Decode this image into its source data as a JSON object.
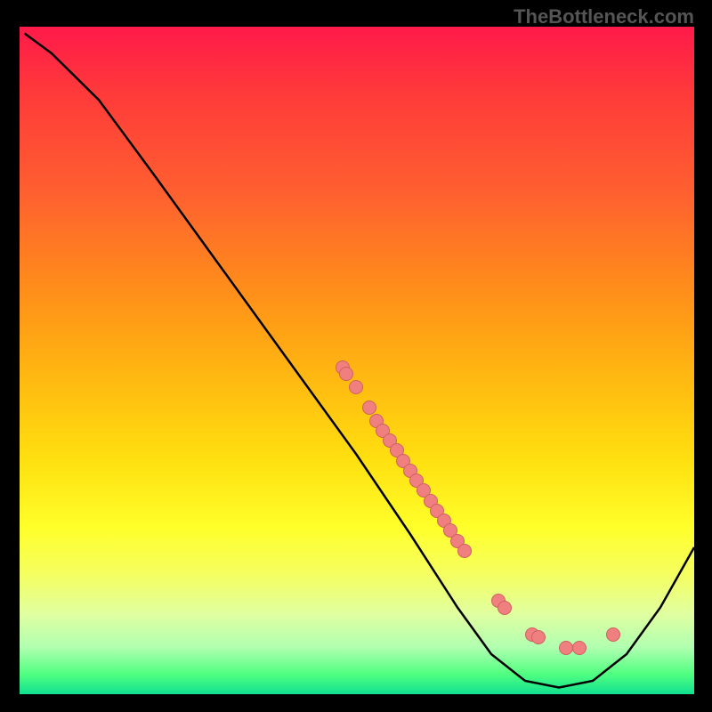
{
  "watermark": "TheBottleneck.com",
  "chart_data": {
    "type": "line",
    "title": "",
    "xlabel": "",
    "ylabel": "",
    "xlim": [
      0,
      100
    ],
    "ylim": [
      0,
      100
    ],
    "curve": [
      {
        "x": 1,
        "y": 99
      },
      {
        "x": 5,
        "y": 96
      },
      {
        "x": 12,
        "y": 89
      },
      {
        "x": 20,
        "y": 78
      },
      {
        "x": 30,
        "y": 64
      },
      {
        "x": 40,
        "y": 50
      },
      {
        "x": 50,
        "y": 36
      },
      {
        "x": 58,
        "y": 24
      },
      {
        "x": 65,
        "y": 13
      },
      {
        "x": 70,
        "y": 6
      },
      {
        "x": 75,
        "y": 2
      },
      {
        "x": 80,
        "y": 1
      },
      {
        "x": 85,
        "y": 2
      },
      {
        "x": 90,
        "y": 6
      },
      {
        "x": 95,
        "y": 13
      },
      {
        "x": 100,
        "y": 22
      }
    ],
    "scatter_points": [
      {
        "x": 48,
        "y": 49
      },
      {
        "x": 48.5,
        "y": 48
      },
      {
        "x": 50,
        "y": 46
      },
      {
        "x": 52,
        "y": 43
      },
      {
        "x": 53,
        "y": 41
      },
      {
        "x": 54,
        "y": 39.5
      },
      {
        "x": 55,
        "y": 38
      },
      {
        "x": 56,
        "y": 36.5
      },
      {
        "x": 57,
        "y": 35
      },
      {
        "x": 58,
        "y": 33.5
      },
      {
        "x": 59,
        "y": 32
      },
      {
        "x": 60,
        "y": 30.5
      },
      {
        "x": 61,
        "y": 29
      },
      {
        "x": 62,
        "y": 27.5
      },
      {
        "x": 63,
        "y": 26
      },
      {
        "x": 64,
        "y": 24.5
      },
      {
        "x": 65,
        "y": 23
      },
      {
        "x": 66,
        "y": 21.5
      },
      {
        "x": 71,
        "y": 14
      },
      {
        "x": 72,
        "y": 13
      },
      {
        "x": 76,
        "y": 9
      },
      {
        "x": 77,
        "y": 8.5
      },
      {
        "x": 81,
        "y": 7
      },
      {
        "x": 83,
        "y": 7
      },
      {
        "x": 88,
        "y": 9
      }
    ],
    "scatter_color": "#f08080",
    "curve_color": "#000000",
    "background_gradient": [
      "#ff1a4a",
      "#ffff2a",
      "#10e090"
    ]
  }
}
